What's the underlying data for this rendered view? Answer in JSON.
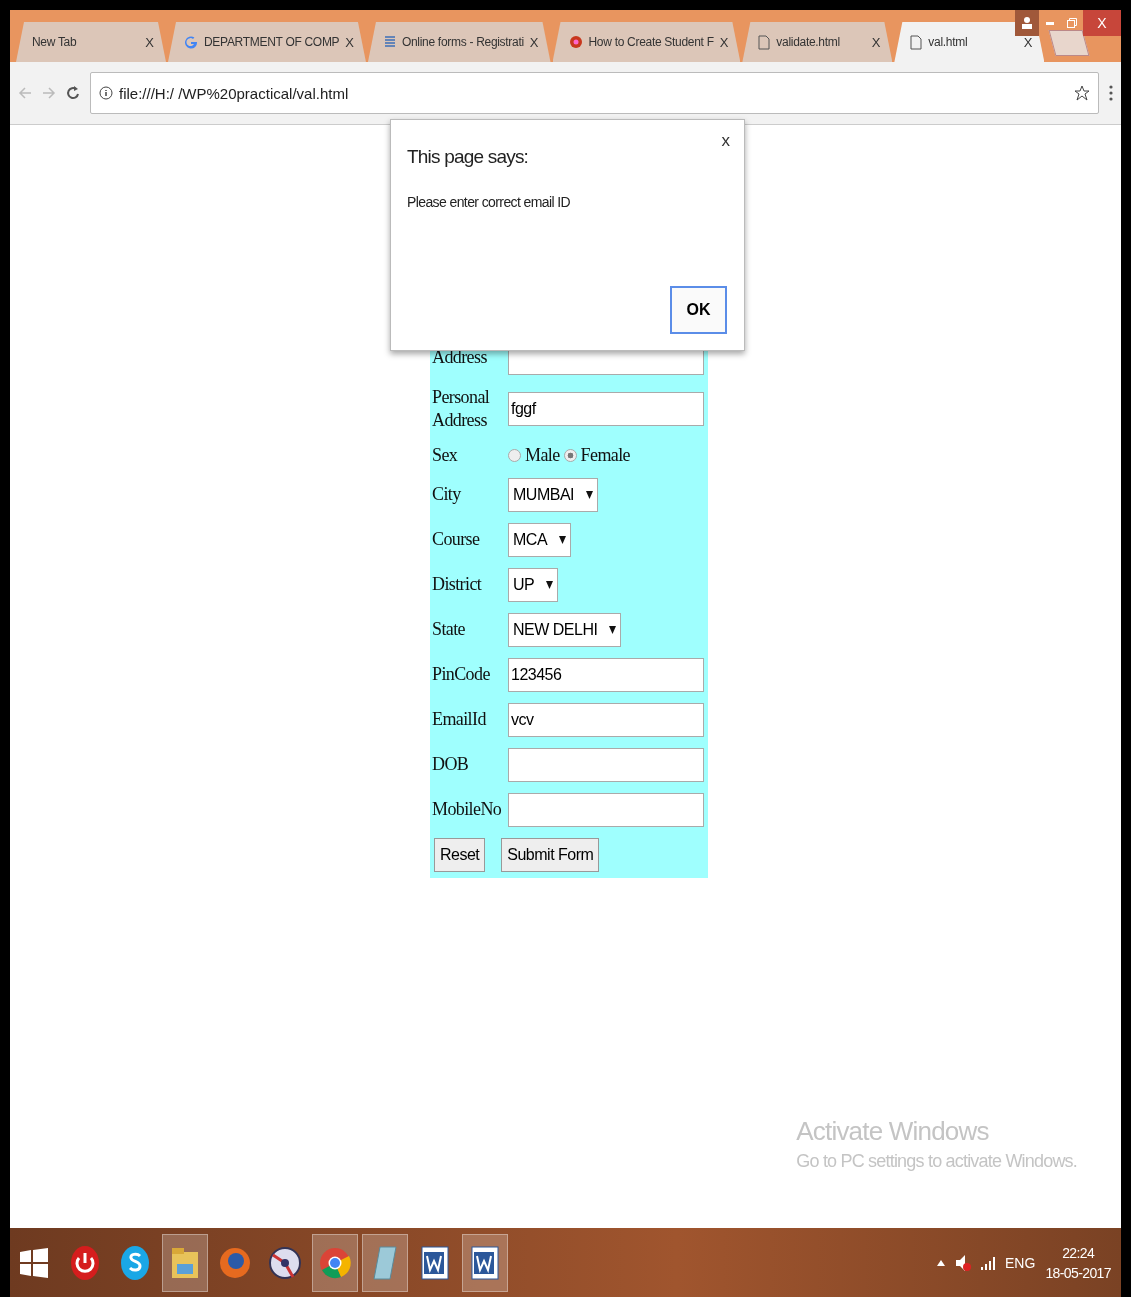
{
  "browser": {
    "tabs": [
      {
        "title": "New Tab",
        "kind": "blank",
        "close": "X",
        "selected": false
      },
      {
        "title": "DEPARTMENT OF COMP",
        "kind": "search",
        "close": "X",
        "selected": false
      },
      {
        "title": "Online forms - Registrati",
        "kind": "form",
        "close": "X",
        "selected": false
      },
      {
        "title": "How to Create Student F",
        "kind": "site",
        "close": "X",
        "selected": false
      },
      {
        "title": "validate.html",
        "kind": "file",
        "close": "X",
        "selected": false
      },
      {
        "title": "val.html",
        "kind": "file",
        "close": "X",
        "selected": true
      }
    ],
    "close_label": "X",
    "url": "file:///H:/ /WP%20practical/val.html"
  },
  "dialog": {
    "title": "This page says:",
    "message": "Please enter correct email ID",
    "close": "x",
    "ok": "OK"
  },
  "form": {
    "rows": [
      {
        "kind": "text",
        "label": "Address",
        "value": ""
      },
      {
        "kind": "text",
        "label": "Personal Address",
        "value": "fggf"
      },
      {
        "kind": "radio",
        "label": "Sex",
        "options": [
          {
            "label": "Male",
            "selected": false
          },
          {
            "label": "Female",
            "selected": true
          }
        ]
      },
      {
        "kind": "select",
        "label": "City",
        "value": "MUMBAI"
      },
      {
        "kind": "select",
        "label": "Course",
        "value": "MCA"
      },
      {
        "kind": "select",
        "label": "District",
        "value": "UP"
      },
      {
        "kind": "select",
        "label": "State",
        "value": "NEW DELHI"
      },
      {
        "kind": "text",
        "label": "PinCode",
        "value": "123456"
      },
      {
        "kind": "text",
        "label": "EmailId",
        "value": "vcv"
      },
      {
        "kind": "text",
        "label": "DOB",
        "value": ""
      },
      {
        "kind": "text",
        "label": "MobileNo",
        "value": ""
      }
    ],
    "buttons": [
      "Reset",
      "Submit Form"
    ]
  },
  "watermark": {
    "title": "Activate Windows",
    "subtitle": "Go to PC settings to activate Windows."
  },
  "taskbar": {
    "apps": [
      {
        "kind": "power",
        "open": false
      },
      {
        "kind": "skype",
        "open": false
      },
      {
        "kind": "folder",
        "open": true
      },
      {
        "kind": "firefox",
        "open": false
      },
      {
        "kind": "disc",
        "open": false
      },
      {
        "kind": "chrome",
        "open": true
      },
      {
        "kind": "notepad",
        "open": true
      },
      {
        "kind": "word",
        "open": false
      },
      {
        "kind": "word",
        "open": true
      }
    ],
    "language": "ENG",
    "time": "22:24",
    "date": "18-05-2017"
  }
}
